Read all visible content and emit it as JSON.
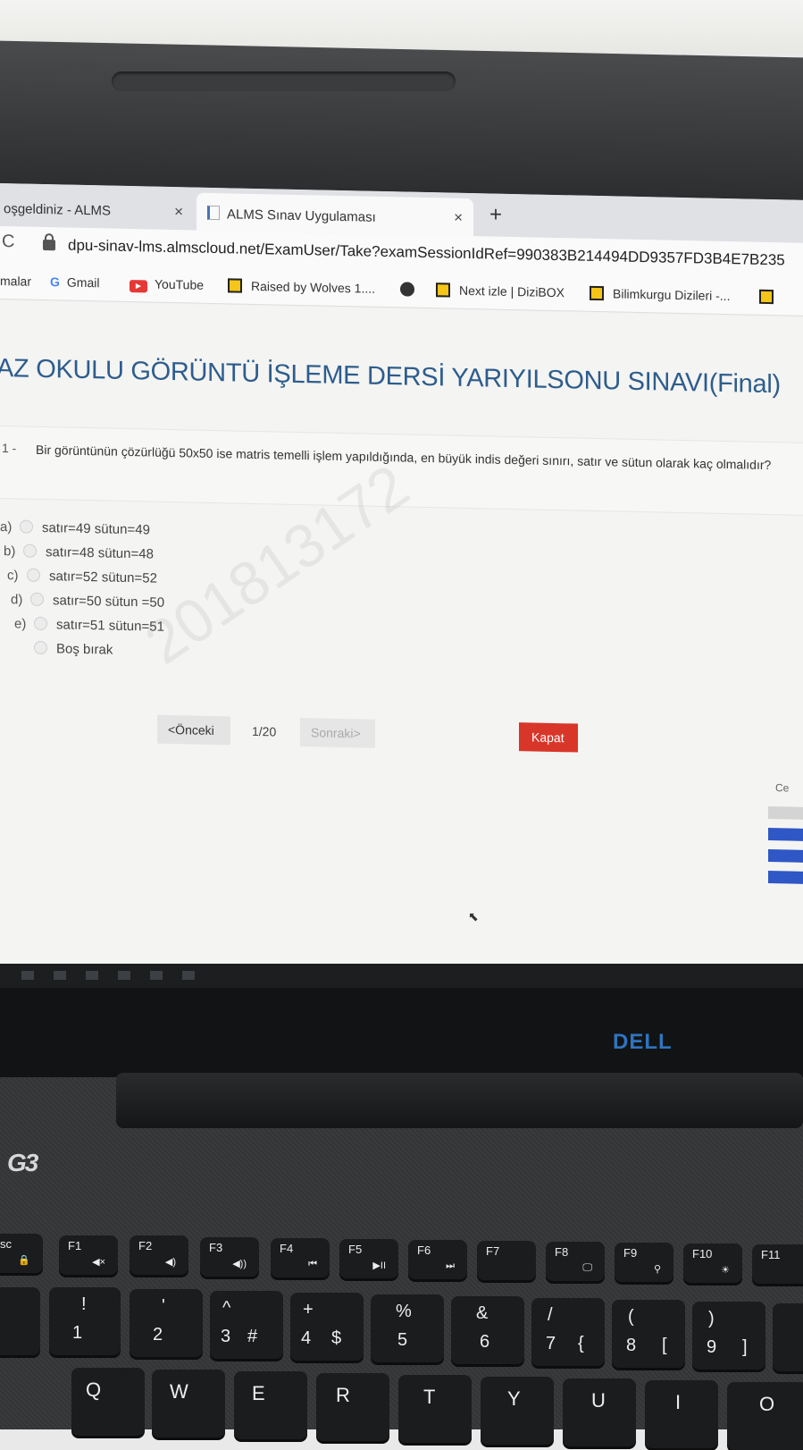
{
  "browser": {
    "tabs": [
      {
        "label": "oşgeldiniz - ALMS",
        "close": "×"
      },
      {
        "label": "ALMS Sınav Uygulaması",
        "close": "×"
      }
    ],
    "new_tab": "+",
    "reload": "C",
    "url": "dpu-sinav-lms.almscloud.net/ExamUser/Take?examSessionIdRef=990383B214494DD9357FD3B4E7B235",
    "bookmarks": [
      {
        "label": "malar",
        "icon": "none"
      },
      {
        "label": "Gmail",
        "icon": "google-icon",
        "glyph": "G"
      },
      {
        "label": "YouTube",
        "icon": "youtube-icon",
        "glyph": "▶"
      },
      {
        "label": "Raised by Wolves 1....",
        "icon": "tv-icon"
      },
      {
        "label": "",
        "icon": "globe-icon"
      },
      {
        "label": "Next izle | DiziBOX",
        "icon": "tv-icon"
      },
      {
        "label": "Bilimkurgu Dizileri -...",
        "icon": "tv-icon"
      }
    ]
  },
  "exam": {
    "title": "AZ OKULU GÖRÜNTÜ İŞLEME DERSİ YARIYILSONU SINAVI(Final)",
    "question_number": "1 -",
    "question_text": "Bir görüntünün çözürlüğü 50x50 ise matris temelli işlem yapıldığında, en büyük indis değeri sınırı, satır ve sütun olarak kaç olmalıdır?",
    "options": [
      {
        "letter": "a)",
        "text": "satır=49 sütun=49"
      },
      {
        "letter": "b)",
        "text": "satır=48 sütun=48"
      },
      {
        "letter": "c)",
        "text": "satır=52 sütun=52"
      },
      {
        "letter": "d)",
        "text": "satır=50 sütun =50"
      },
      {
        "letter": "e)",
        "text": "satır=51 sütun=51"
      },
      {
        "letter": "",
        "text": "Boş bırak"
      }
    ],
    "watermark": "201813172",
    "prev_label": "<Önceki",
    "pager": "1/20",
    "next_label": "Sonraki>",
    "close_label": "Kapat",
    "side_label": "Ce"
  },
  "laptop": {
    "brand": "DELL",
    "model": "G3",
    "fn_keys": [
      "sc",
      "F1",
      "F2",
      "F3",
      "F4",
      "F5",
      "F6",
      "F7",
      "F8",
      "F9",
      "F10",
      "F11"
    ],
    "fn_sub": [
      "🔒",
      "◀×",
      "◀)",
      "◀))",
      "⏮",
      "▶II",
      "⏭",
      "",
      "🖵",
      "⚲",
      "☀",
      ""
    ],
    "num_keys": [
      {
        "top": "!",
        "bottom": "1",
        "extra": ""
      },
      {
        "top": "'",
        "bottom": "2",
        "extra": ""
      },
      {
        "top": "^",
        "bottom": "3",
        "extra": "#"
      },
      {
        "top": "+",
        "bottom": "4",
        "extra": "$"
      },
      {
        "top": "%",
        "bottom": "5",
        "extra": ""
      },
      {
        "top": "&",
        "bottom": "6",
        "extra": ""
      },
      {
        "top": "/",
        "bottom": "7",
        "extra": "{"
      },
      {
        "top": "(",
        "bottom": "8",
        "extra": "["
      },
      {
        "top": ")",
        "bottom": "9",
        "extra": "]"
      }
    ],
    "letter_keys": [
      "Q",
      "W",
      "E",
      "R",
      "T",
      "Y",
      "U",
      "I",
      "O"
    ]
  }
}
